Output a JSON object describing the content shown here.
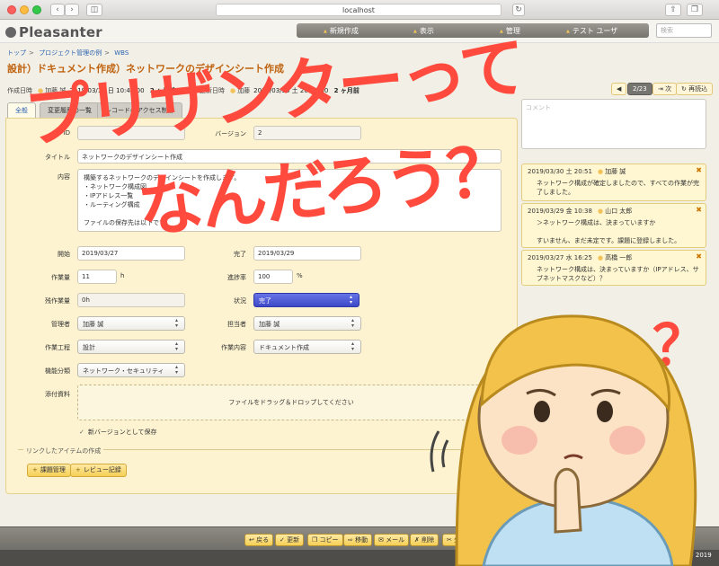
{
  "browser": {
    "url": "localhost"
  },
  "app": {
    "logo": "Pleasanter"
  },
  "nav": {
    "items": [
      "新規作成",
      "表示",
      "管理",
      "テスト ユーザ"
    ],
    "search_placeholder": "検索"
  },
  "breadcrumb": [
    "トップ",
    "プロジェクト管理の例",
    "WBS"
  ],
  "title": "設計）ドキュメント作成）ネットワークのデザインシート作成",
  "meta": {
    "created_label": "作成日時",
    "created_user": "加藤 誠",
    "created_value": "2019/03/17 日 10:41:00",
    "created_ago": "2 ヶ月前",
    "updated_label": "更新日時",
    "updated_user": "加藤",
    "updated_value": "2019/03/30 土 20:51:00",
    "updated_ago": "2 ヶ月前"
  },
  "pager": {
    "count": "2/23",
    "next": "次",
    "reload": "再読込"
  },
  "tabs": [
    "全般",
    "変更履歴の一覧",
    "レコードのアクセス制御"
  ],
  "form": {
    "id_label": "ID",
    "version_label": "バージョン",
    "version_value": "2",
    "title_label": "タイトル",
    "title_value": "ネットワークのデザインシート作成",
    "desc_label": "内容",
    "desc_value": "構築するネットワークのデザインシートを作成します。\n  ・ネットワーク構成図\n  ・IPアドレス一覧\n  ・ルーティング構成\n\nファイルの保存先は以下です。\n\n\\\\fileserver\\share\\project\\design\\",
    "start_label": "開始",
    "start_value": "2019/03/27",
    "end_label": "完了",
    "end_value": "2019/03/29",
    "work_label": "作業量",
    "work_value": "11",
    "work_unit": "h",
    "progress_label": "進捗率",
    "progress_value": "100",
    "progress_unit": "%",
    "remain_label": "残作業量",
    "remain_value": "0h",
    "status_label": "状況",
    "status_value": "完了",
    "manager_label": "管理者",
    "manager_value": "加藤 誠",
    "owner_label": "担当者",
    "owner_value": "加藤 誠",
    "process_label": "作業工程",
    "process_value": "設計",
    "content_label": "作業内容",
    "content_value": "ドキュメント作成",
    "category_label": "機能分類",
    "category_value": "ネットワーク・セキュリティ",
    "attach_label": "添付資料",
    "attach_drop": "ファイルをドラッグ＆ドロップしてください",
    "new_version": "新バージョンとして保存",
    "linked_title": "リンクしたアイテムの作成",
    "linked_buttons": [
      "課題管理",
      "レビュー記録"
    ]
  },
  "comments": {
    "placeholder": "コメント",
    "items": [
      {
        "date": "2019/03/30 土 20:51",
        "user": "加藤 誠",
        "text": "ネットワーク構成が確定しましたので、すべての作業が完了しました。"
      },
      {
        "date": "2019/03/29 金 10:38",
        "user": "山口 太郎",
        "text": "＞ネットワーク構成は、決まっていますか\n\nすいません、まだ未定です。課題に登録しました。"
      },
      {
        "date": "2019/03/27 水 16:25",
        "user": "高橋 一郎",
        "text": "ネットワーク構成は、決まっていますか（IPアドレス、サブネットマスクなど）？"
      }
    ]
  },
  "bottom": {
    "buttons": [
      "戻る",
      "更新",
      "コピー",
      "移動",
      "メール",
      "削除",
      "分割"
    ],
    "copyright": "Copyright © Implem Inc. 2014 - 2019"
  },
  "overlay": {
    "line1": "プリザンターって",
    "line2": "なんだろう？",
    "q": "？"
  },
  "colors": {
    "accent": "#c0620e",
    "overlay": "#ff4a3d",
    "panel": "#fdf3d0",
    "status": "#3e48c8"
  }
}
